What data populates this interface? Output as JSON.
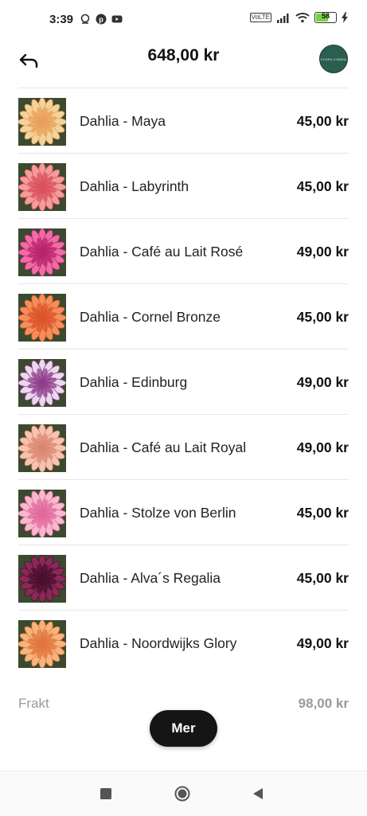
{
  "status": {
    "time": "3:39",
    "battery": "58",
    "icons": [
      "location-icon",
      "pinterest-icon",
      "youtube-icon"
    ],
    "right_icons": [
      "volte-icon",
      "signal-icon",
      "wifi-icon",
      "battery-icon",
      "charging-icon"
    ],
    "volte": "VoLTE"
  },
  "header": {
    "total": "648,00 kr",
    "logo_text": "FLORA LINNEA"
  },
  "items": [
    {
      "name": "Dahlia - Maya",
      "price": "45,00 kr",
      "colors": [
        "#f4d29a",
        "#e8a05b"
      ]
    },
    {
      "name": "Dahlia - Labyrinth",
      "price": "45,00 kr",
      "colors": [
        "#f49b9b",
        "#d9525e"
      ]
    },
    {
      "name": "Dahlia - Café au Lait Rosé",
      "price": "49,00 kr",
      "colors": [
        "#f06ca6",
        "#b8236a"
      ]
    },
    {
      "name": "Dahlia - Cornel Bronze",
      "price": "45,00 kr",
      "colors": [
        "#f58f5a",
        "#d9542c"
      ]
    },
    {
      "name": "Dahlia - Edinburg",
      "price": "49,00 kr",
      "colors": [
        "#ead8ee",
        "#8d3d89"
      ]
    },
    {
      "name": "Dahlia - Café au Lait Royal",
      "price": "49,00 kr",
      "colors": [
        "#f7c3b0",
        "#d98870"
      ]
    },
    {
      "name": "Dahlia - Stolze von Berlin",
      "price": "45,00 kr",
      "colors": [
        "#f9b7cf",
        "#e06a9b"
      ]
    },
    {
      "name": "Dahlia - Alva´s Regalia",
      "price": "45,00 kr",
      "colors": [
        "#8a2957",
        "#4a0f2e"
      ]
    },
    {
      "name": "Dahlia - Noordwijks Glory",
      "price": "49,00 kr",
      "colors": [
        "#f7b47d",
        "#e0763e"
      ]
    }
  ],
  "shipping": {
    "label": "Frakt",
    "value": "98,00 kr"
  },
  "more_button": "Mer",
  "accent": "#151515"
}
